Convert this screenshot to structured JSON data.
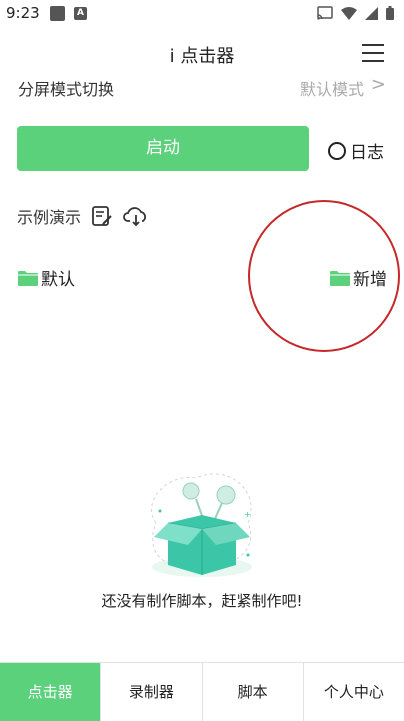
{
  "status_bar": {
    "time": "9:23",
    "badge": "A"
  },
  "header": {
    "title": "i 点击器"
  },
  "mode_row": {
    "label": "分屏模式切换",
    "value": "默认模式",
    "chevron": ">"
  },
  "start_button": {
    "label": "启动"
  },
  "log": {
    "label": "日志"
  },
  "demo": {
    "label": "示例演示"
  },
  "folders": [
    {
      "label": "默认"
    },
    {
      "label": "新增"
    }
  ],
  "empty_state": {
    "text": "还没有制作脚本，赶紧制作吧!"
  },
  "tabs": [
    {
      "label": "点击器",
      "active": true
    },
    {
      "label": "录制器",
      "active": false
    },
    {
      "label": "脚本",
      "active": false
    },
    {
      "label": "个人中心",
      "active": false
    }
  ],
  "colors": {
    "accent": "#5cd17c",
    "highlight_circle": "#c62828"
  }
}
